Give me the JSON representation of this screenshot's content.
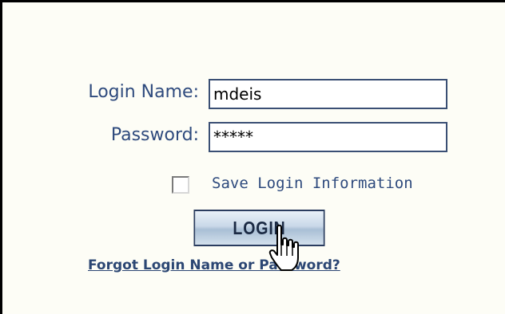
{
  "form": {
    "login_name_label": "Login Name:",
    "login_name_value": "mdeis",
    "password_label": "Password:",
    "password_value": "*****",
    "save_login_label": "Save Login Information",
    "save_login_checked": false,
    "login_button_label": "LOGIN",
    "forgot_link_label": "Forgot Login Name or Password?"
  },
  "colors": {
    "label_text": "#2e4a7d",
    "link_text": "#2b4673",
    "background": "#fdfdf6",
    "button_border": "#2a3c5f"
  },
  "icons": {
    "cursor": "hand-pointer-icon"
  }
}
